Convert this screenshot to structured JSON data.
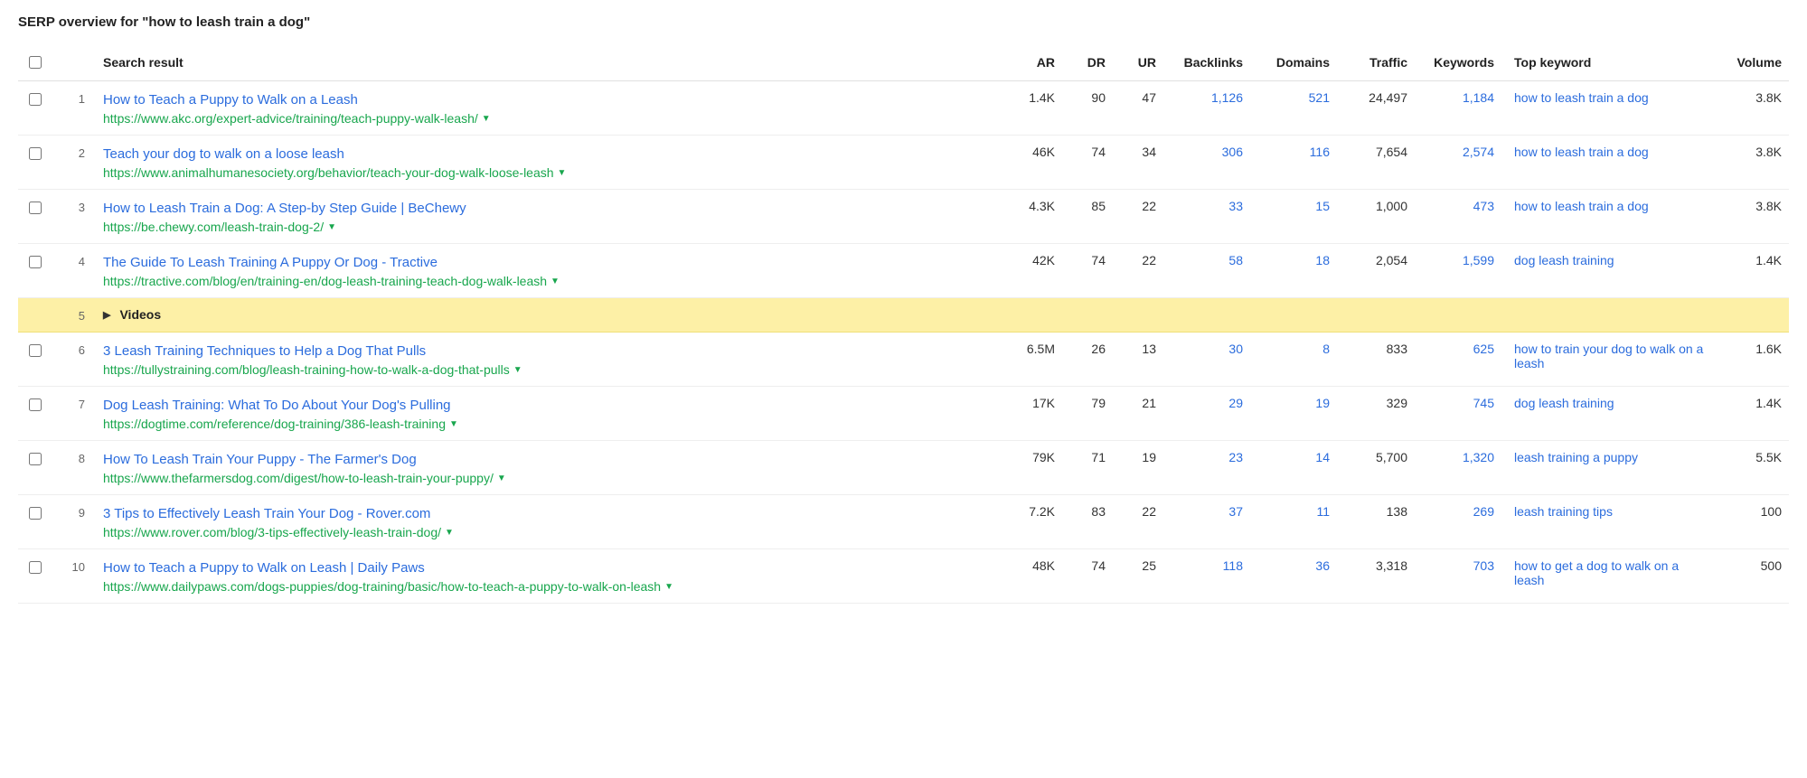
{
  "title": "SERP overview for \"how to leash train a dog\"",
  "columns": {
    "search_result": "Search result",
    "ar": "AR",
    "dr": "DR",
    "ur": "UR",
    "backlinks": "Backlinks",
    "domains": "Domains",
    "traffic": "Traffic",
    "keywords": "Keywords",
    "top_keyword": "Top keyword",
    "volume": "Volume"
  },
  "rows": [
    {
      "type": "result",
      "pos": "1",
      "title": "How to Teach a Puppy to Walk on a Leash",
      "url": "https://www.akc.org/expert-advice/training/teach-puppy-walk-leash/",
      "ar": "1.4K",
      "dr": "90",
      "ur": "47",
      "backlinks": "1,126",
      "domains": "521",
      "traffic": "24,497",
      "keywords": "1,184",
      "top_keyword": "how to leash train a dog",
      "volume": "3.8K"
    },
    {
      "type": "result",
      "pos": "2",
      "title": "Teach your dog to walk on a loose leash",
      "url": "https://www.animalhumanesociety.org/behavior/teach-your-dog-walk-loose-leash",
      "ar": "46K",
      "dr": "74",
      "ur": "34",
      "backlinks": "306",
      "domains": "116",
      "traffic": "7,654",
      "keywords": "2,574",
      "top_keyword": "how to leash train a dog",
      "volume": "3.8K"
    },
    {
      "type": "result",
      "pos": "3",
      "title": "How to Leash Train a Dog: A Step-by Step Guide | BeChewy",
      "url": "https://be.chewy.com/leash-train-dog-2/",
      "ar": "4.3K",
      "dr": "85",
      "ur": "22",
      "backlinks": "33",
      "domains": "15",
      "traffic": "1,000",
      "keywords": "473",
      "top_keyword": "how to leash train a dog",
      "volume": "3.8K"
    },
    {
      "type": "result",
      "pos": "4",
      "title": "The Guide To Leash Training A Puppy Or Dog - Tractive",
      "url": "https://tractive.com/blog/en/training-en/dog-leash-training-teach-dog-walk-leash",
      "ar": "42K",
      "dr": "74",
      "ur": "22",
      "backlinks": "58",
      "domains": "18",
      "traffic": "2,054",
      "keywords": "1,599",
      "top_keyword": "dog leash training",
      "volume": "1.4K"
    },
    {
      "type": "videos",
      "pos": "5",
      "label": "Videos"
    },
    {
      "type": "result",
      "pos": "6",
      "title": "3 Leash Training Techniques to Help a Dog That Pulls",
      "url": "https://tullystraining.com/blog/leash-training-how-to-walk-a-dog-that-pulls",
      "ar": "6.5M",
      "dr": "26",
      "ur": "13",
      "backlinks": "30",
      "domains": "8",
      "traffic": "833",
      "keywords": "625",
      "top_keyword": "how to train your dog to walk on a leash",
      "volume": "1.6K"
    },
    {
      "type": "result",
      "pos": "7",
      "title": "Dog Leash Training: What To Do About Your Dog's Pulling",
      "url": "https://dogtime.com/reference/dog-training/386-leash-training",
      "ar": "17K",
      "dr": "79",
      "ur": "21",
      "backlinks": "29",
      "domains": "19",
      "traffic": "329",
      "keywords": "745",
      "top_keyword": "dog leash training",
      "volume": "1.4K"
    },
    {
      "type": "result",
      "pos": "8",
      "title": "How To Leash Train Your Puppy - The Farmer's Dog",
      "url": "https://www.thefarmersdog.com/digest/how-to-leash-train-your-puppy/",
      "ar": "79K",
      "dr": "71",
      "ur": "19",
      "backlinks": "23",
      "domains": "14",
      "traffic": "5,700",
      "keywords": "1,320",
      "top_keyword": "leash training a puppy",
      "volume": "5.5K"
    },
    {
      "type": "result",
      "pos": "9",
      "title": "3 Tips to Effectively Leash Train Your Dog - Rover.com",
      "url": "https://www.rover.com/blog/3-tips-effectively-leash-train-dog/",
      "ar": "7.2K",
      "dr": "83",
      "ur": "22",
      "backlinks": "37",
      "domains": "11",
      "traffic": "138",
      "keywords": "269",
      "top_keyword": "leash training tips",
      "volume": "100"
    },
    {
      "type": "result",
      "pos": "10",
      "title": "How to Teach a Puppy to Walk on Leash | Daily Paws",
      "url": "https://www.dailypaws.com/dogs-puppies/dog-training/basic/how-to-teach-a-puppy-to-walk-on-leash",
      "ar": "48K",
      "dr": "74",
      "ur": "25",
      "backlinks": "118",
      "domains": "36",
      "traffic": "3,318",
      "keywords": "703",
      "top_keyword": "how to get a dog to walk on a leash",
      "volume": "500"
    }
  ]
}
